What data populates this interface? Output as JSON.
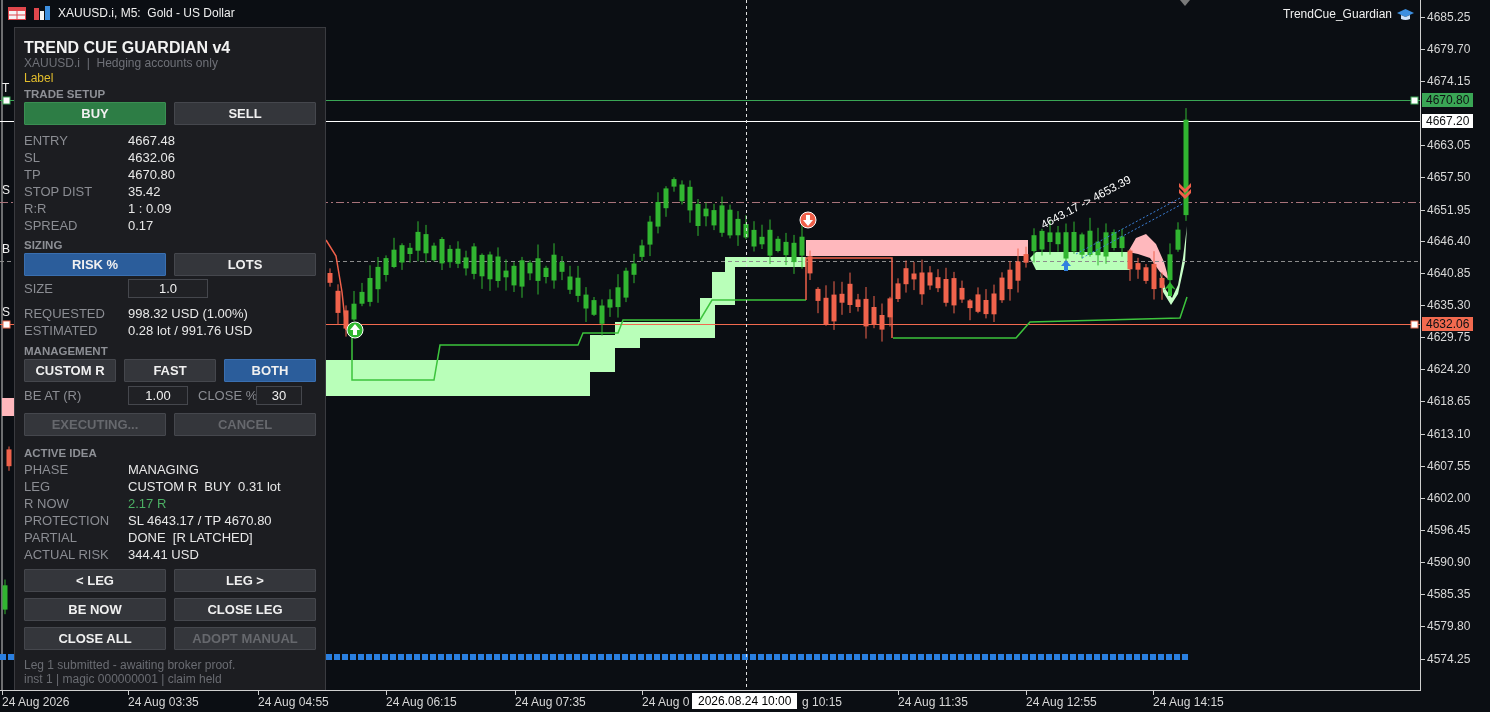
{
  "chart_header": {
    "title": "XAUUSD.i, M5:  Gold - US Dollar",
    "indicator": "TrendCue_Guardian"
  },
  "panel": {
    "title": "TREND CUE GUARDIAN v4",
    "subtitle": "XAUUSD.i  |  Hedging accounts only",
    "tag": "Label",
    "trade_setup": {
      "heading": "TRADE SETUP",
      "buttons": [
        {
          "label": "BUY",
          "kind": "buy",
          "selected": true
        },
        {
          "label": "SELL",
          "kind": "sell",
          "selected": false
        }
      ],
      "rows": [
        {
          "label": "ENTRY",
          "value": "4667.48"
        },
        {
          "label": "SL",
          "value": "4632.06"
        },
        {
          "label": "TP",
          "value": "4670.80"
        },
        {
          "label": "STOP DIST",
          "value": "35.42"
        },
        {
          "label": "R:R",
          "value": "1 : 0.09"
        },
        {
          "label": "SPREAD",
          "value": "0.17"
        }
      ]
    },
    "sizing": {
      "heading": "SIZING",
      "buttons": [
        {
          "label": "RISK %",
          "selected": true
        },
        {
          "label": "LOTS",
          "selected": false
        }
      ],
      "size": {
        "label": "SIZE",
        "value": "1.0"
      },
      "rows": [
        {
          "label": "REQUESTED",
          "value": "998.32 USD (1.00%)"
        },
        {
          "label": "ESTIMATED",
          "value": "0.28 lot / 991.76 USD"
        }
      ]
    },
    "management": {
      "heading": "MANAGEMENT",
      "buttons": [
        {
          "label": "CUSTOM R",
          "selected": false
        },
        {
          "label": "FAST",
          "selected": false
        },
        {
          "label": "BOTH",
          "selected": true
        }
      ],
      "be_at": {
        "label": "BE AT (R)",
        "value": "1.00"
      },
      "close_pct": {
        "label": "CLOSE %",
        "value": "30"
      },
      "actions": [
        {
          "label": "EXECUTING...",
          "disabled": true
        },
        {
          "label": "CANCEL",
          "disabled": true
        }
      ]
    },
    "active_idea": {
      "heading": "ACTIVE IDEA",
      "rows": [
        {
          "label": "PHASE",
          "value": "MANAGING",
          "kind": "plain"
        },
        {
          "label": "LEG",
          "value": "CUSTOM R  BUY  0.31 lot",
          "kind": "plain"
        },
        {
          "label": "R NOW",
          "value": "2.17 R",
          "kind": "gain"
        },
        {
          "label": "PROTECTION",
          "value": "SL 4643.17 / TP 4670.80",
          "kind": "plain"
        },
        {
          "label": "PARTIAL",
          "value": "DONE  [R LATCHED]",
          "kind": "plain"
        },
        {
          "label": "ACTUAL RISK",
          "value": "344.41 USD",
          "kind": "plain"
        }
      ],
      "actions": [
        {
          "label": "< LEG",
          "disabled": false
        },
        {
          "label": "LEG >",
          "disabled": false
        },
        {
          "label": "BE NOW",
          "disabled": false
        },
        {
          "label": "CLOSE LEG",
          "disabled": false
        },
        {
          "label": "CLOSE ALL",
          "disabled": false
        },
        {
          "label": "ADOPT MANUAL",
          "disabled": true
        }
      ]
    },
    "status": [
      "Leg 1 submitted - awaiting broker proof.",
      "inst 1 | magic 000000001 | claim held"
    ]
  },
  "chart": {
    "levels": [
      {
        "kind": "solid",
        "color": "#3aa655",
        "label": "T",
        "tag": "4670.80",
        "selected": true
      },
      {
        "kind": "solid",
        "color": "#ffffff",
        "tag": "4667.20",
        "selected": false
      },
      {
        "kind": "dashdot",
        "color": "#a8737a",
        "label": "S",
        "selected": false
      },
      {
        "kind": "dashed",
        "color": "#8c8c8c",
        "label": "B",
        "selected": false
      },
      {
        "kind": "solid",
        "color": "#f26a4f",
        "label": "S",
        "tag": "4632.06",
        "selected": true
      }
    ],
    "projection_label": "4643.17 -> 4653.39",
    "price_axis": [
      "4685.25",
      "4679.70",
      "4674.15",
      "4663.05",
      "4657.50",
      "4651.95",
      "4646.40",
      "4640.85",
      "4635.30",
      "4629.75",
      "4624.20",
      "4618.65",
      "4613.10",
      "4607.55",
      "4602.00",
      "4596.45",
      "4590.90",
      "4585.35",
      "4579.80",
      "4574.25"
    ],
    "time_axis": [
      "24 Aug 2026",
      "24 Aug 03:35",
      "24 Aug 04:55",
      "24 Aug 06:15",
      "24 Aug 07:35",
      "24 Aug 0",
      "g 10:15",
      "24 Aug 11:35",
      "24 Aug 12:55",
      "24 Aug 14:15"
    ],
    "crosshair_time": "2026.08.24 10:00"
  }
}
